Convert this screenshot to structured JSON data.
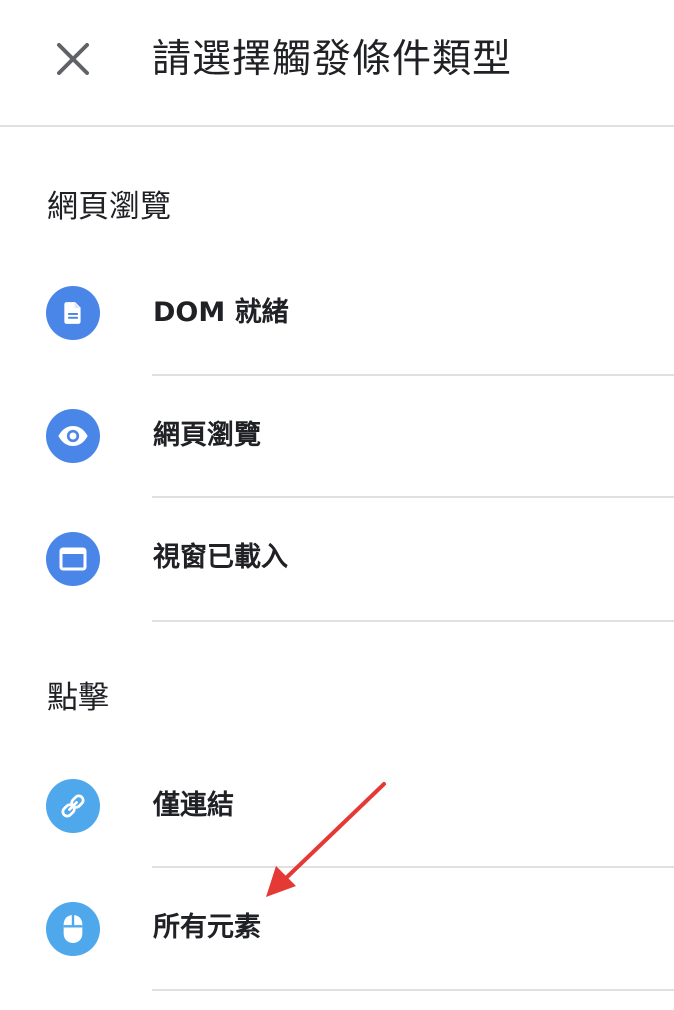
{
  "header": {
    "title": "請選擇觸發條件類型"
  },
  "sections": [
    {
      "label": "網頁瀏覽",
      "items": [
        {
          "label": "DOM 就緒",
          "icon": "document-icon"
        },
        {
          "label": "網頁瀏覽",
          "icon": "eye-icon"
        },
        {
          "label": "視窗已載入",
          "icon": "window-icon"
        }
      ]
    },
    {
      "label": "點擊",
      "items": [
        {
          "label": "僅連結",
          "icon": "link-icon"
        },
        {
          "label": "所有元素",
          "icon": "mouse-icon"
        }
      ]
    }
  ],
  "colors": {
    "pageview_icon_bg": "#4a86e8",
    "click_icon_bg": "#4fa8ec",
    "annotation_arrow": "#e53935"
  }
}
